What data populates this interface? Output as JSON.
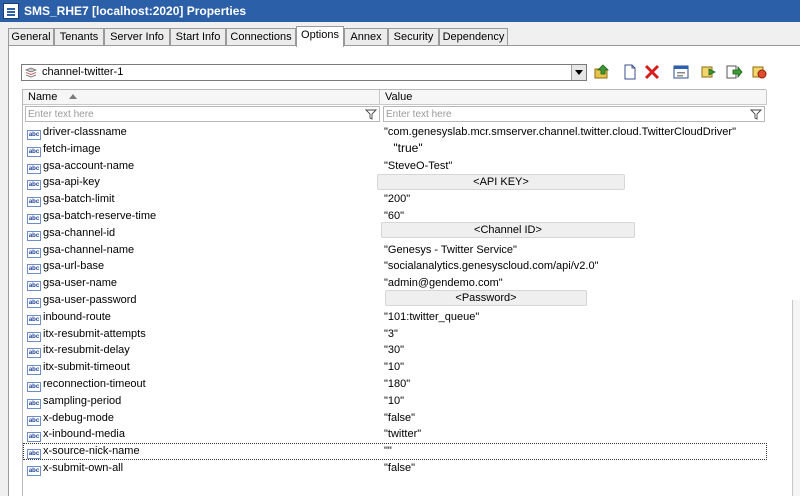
{
  "window": {
    "title": "SMS_RHE7 [localhost:2020] Properties",
    "icon": "app-properties-icon"
  },
  "tabs": [
    {
      "label": "General",
      "active": false
    },
    {
      "label": "Tenants",
      "active": false
    },
    {
      "label": "Server Info",
      "active": false
    },
    {
      "label": "Start Info",
      "active": false
    },
    {
      "label": "Connections",
      "active": false
    },
    {
      "label": "Options",
      "active": true
    },
    {
      "label": "Annex",
      "active": false
    },
    {
      "label": "Security",
      "active": false
    },
    {
      "label": "Dependency",
      "active": false
    }
  ],
  "section_combo": {
    "value": "channel-twitter-1",
    "icon": "section-stack-icon"
  },
  "toolbar": {
    "icons": [
      "folder-up-icon",
      "new-document-icon",
      "delete-x-icon",
      "view-window-icon",
      "copy-section-icon",
      "export-section-icon",
      "import-section-icon"
    ]
  },
  "grid": {
    "columns": {
      "name": "Name",
      "value": "Value"
    },
    "filter_placeholder": "Enter text here",
    "rows": [
      {
        "name": "driver-classname",
        "value": "\"com.genesyslab.mcr.smserver.channel.twitter.cloud.TwitterCloudDriver\""
      },
      {
        "name": "fetch-image",
        "value": ""
      },
      {
        "name": "gsa-account-name",
        "value": "\"SteveO-Test\""
      },
      {
        "name": "gsa-api-key",
        "value": ""
      },
      {
        "name": "gsa-batch-limit",
        "value": "\"200\""
      },
      {
        "name": "gsa-batch-reserve-time",
        "value": "\"60\""
      },
      {
        "name": "gsa-channel-id",
        "value": ""
      },
      {
        "name": "gsa-channel-name",
        "value": "\"Genesys - Twitter Service\""
      },
      {
        "name": "gsa-url-base",
        "value": "\"socialanalytics.genesyscloud.com/api/v2.0\""
      },
      {
        "name": "gsa-user-name",
        "value": "\"admin@gendemo.com\""
      },
      {
        "name": "gsa-user-password",
        "value": ""
      },
      {
        "name": "inbound-route",
        "value": "\"101:twitter_queue\""
      },
      {
        "name": "itx-resubmit-attempts",
        "value": "\"3\""
      },
      {
        "name": "itx-resubmit-delay",
        "value": "\"30\""
      },
      {
        "name": "itx-submit-timeout",
        "value": "\"10\""
      },
      {
        "name": "reconnection-timeout",
        "value": "\"180\""
      },
      {
        "name": "sampling-period",
        "value": "\"10\""
      },
      {
        "name": "x-debug-mode",
        "value": "\"false\""
      },
      {
        "name": "x-inbound-media",
        "value": "\"twitter\""
      },
      {
        "name": "x-source-nick-name",
        "value": "\"\""
      },
      {
        "name": "x-submit-own-all",
        "value": "\"false\""
      }
    ]
  },
  "overlays": {
    "fetch_image": "\"true\"",
    "api_key": "<API KEY>",
    "channel_id": "<Channel ID>",
    "password": "<Password>"
  }
}
